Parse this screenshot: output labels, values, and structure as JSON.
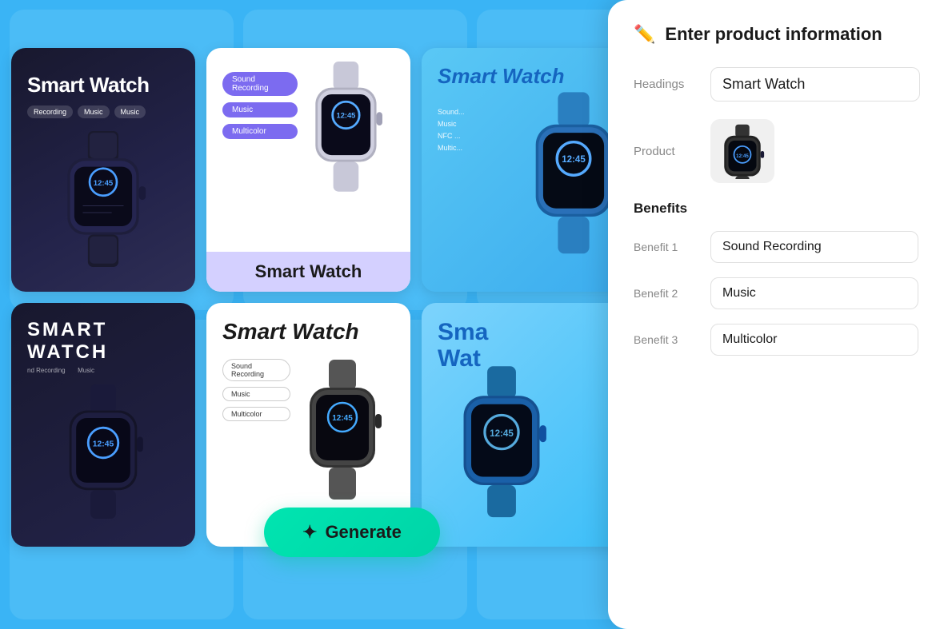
{
  "background": {
    "color": "#3ab4f5"
  },
  "cards": [
    {
      "id": "card-1",
      "style": "dark",
      "title": "Smart Watch",
      "tags": [
        "Recording",
        "Music",
        "Music"
      ],
      "image": "watch-dark"
    },
    {
      "id": "card-2",
      "style": "white-purple",
      "tags": [
        "Sound Recording",
        "Music",
        "Multicolor"
      ],
      "footer_title": "Smart Watch",
      "image": "watch-silver"
    },
    {
      "id": "card-3",
      "style": "blue",
      "title": "Smart Watch",
      "features": [
        "Sound...",
        "Music",
        "NFC...",
        "Multic..."
      ],
      "image": "watch-blue"
    },
    {
      "id": "card-4",
      "style": "dark-2",
      "title": "SMART WATCH",
      "subtitle": "nd Recording        Music",
      "image": "watch-dark-2"
    },
    {
      "id": "card-5",
      "style": "white-italic",
      "title": "Smart Watch",
      "tags": [
        "Sound Recording",
        "Music",
        "Multicolor"
      ],
      "image": "watch-white"
    },
    {
      "id": "card-6",
      "style": "blue-2",
      "title": "Sma\nWat",
      "image": "watch-blue-2"
    }
  ],
  "generate_button": {
    "label": "Generate",
    "icon": "✦"
  },
  "right_panel": {
    "title": "Enter product information",
    "edit_icon": "✏",
    "fields": {
      "headings_label": "Headings",
      "headings_value": "Smart Watch",
      "product_label": "Product"
    },
    "benefits": {
      "title": "Benefits",
      "items": [
        {
          "label": "Benefit 1",
          "value": "Sound Recording"
        },
        {
          "label": "Benefit 2",
          "value": "Music"
        },
        {
          "label": "Benefit 3",
          "value": "Multicolor"
        }
      ]
    }
  }
}
